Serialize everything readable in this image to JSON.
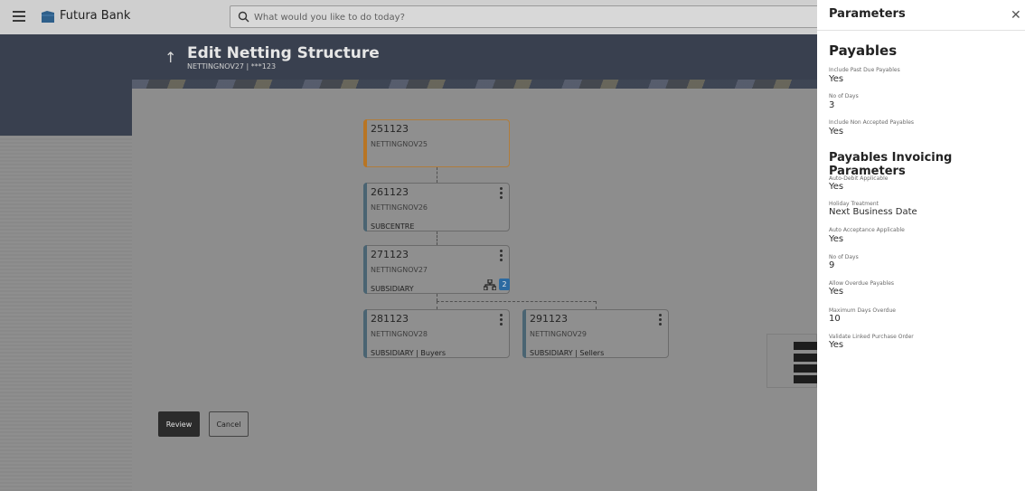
{
  "topbar": {
    "brand": "Futura Bank",
    "search_placeholder": "What would you like to do today?"
  },
  "header": {
    "title": "Edit Netting Structure",
    "subtitle": "NETTINGNOV27 | ***123"
  },
  "tree": {
    "nodes": [
      {
        "code": "251123",
        "name": "NETTINGNOV25",
        "role": ""
      },
      {
        "code": "261123",
        "name": "NETTINGNOV26",
        "role": "SUBCENTRE"
      },
      {
        "code": "271123",
        "name": "NETTINGNOV27",
        "role": "SUBSIDIARY",
        "child_count": "2"
      },
      {
        "code": "281123",
        "name": "NETTINGNOV28",
        "role": "SUBSIDIARY | Buyers"
      },
      {
        "code": "291123",
        "name": "NETTINGNOV29",
        "role": "SUBSIDIARY | Sellers"
      }
    ]
  },
  "actions": {
    "review_label": "Review",
    "cancel_label": "Cancel"
  },
  "panel": {
    "title": "Parameters",
    "sections": [
      {
        "heading": "Payables",
        "fields": [
          {
            "label": "Include Past Due Payables",
            "value": "Yes"
          },
          {
            "label": "No of Days",
            "value": "3"
          },
          {
            "label": "Include Non Accepted Payables",
            "value": "Yes"
          }
        ]
      },
      {
        "heading": "Payables Invoicing Parameters",
        "fields": [
          {
            "label": "Auto-Debit Applicable",
            "value": "Yes"
          },
          {
            "label": "Holiday Treatment",
            "value": "Next Business Date"
          },
          {
            "label": "Auto Acceptance Applicable",
            "value": "Yes"
          },
          {
            "label": "No of Days",
            "value": "9"
          },
          {
            "label": "Allow Overdue Payables",
            "value": "Yes"
          },
          {
            "label": "Maximum Days Overdue",
            "value": "10"
          },
          {
            "label": "Validate Linked Purchase Order",
            "value": "Yes"
          }
        ]
      }
    ]
  },
  "colors": {
    "root_accent": "#b87524",
    "node_accent": "#4a6472",
    "badge": "#2c6aa1"
  }
}
